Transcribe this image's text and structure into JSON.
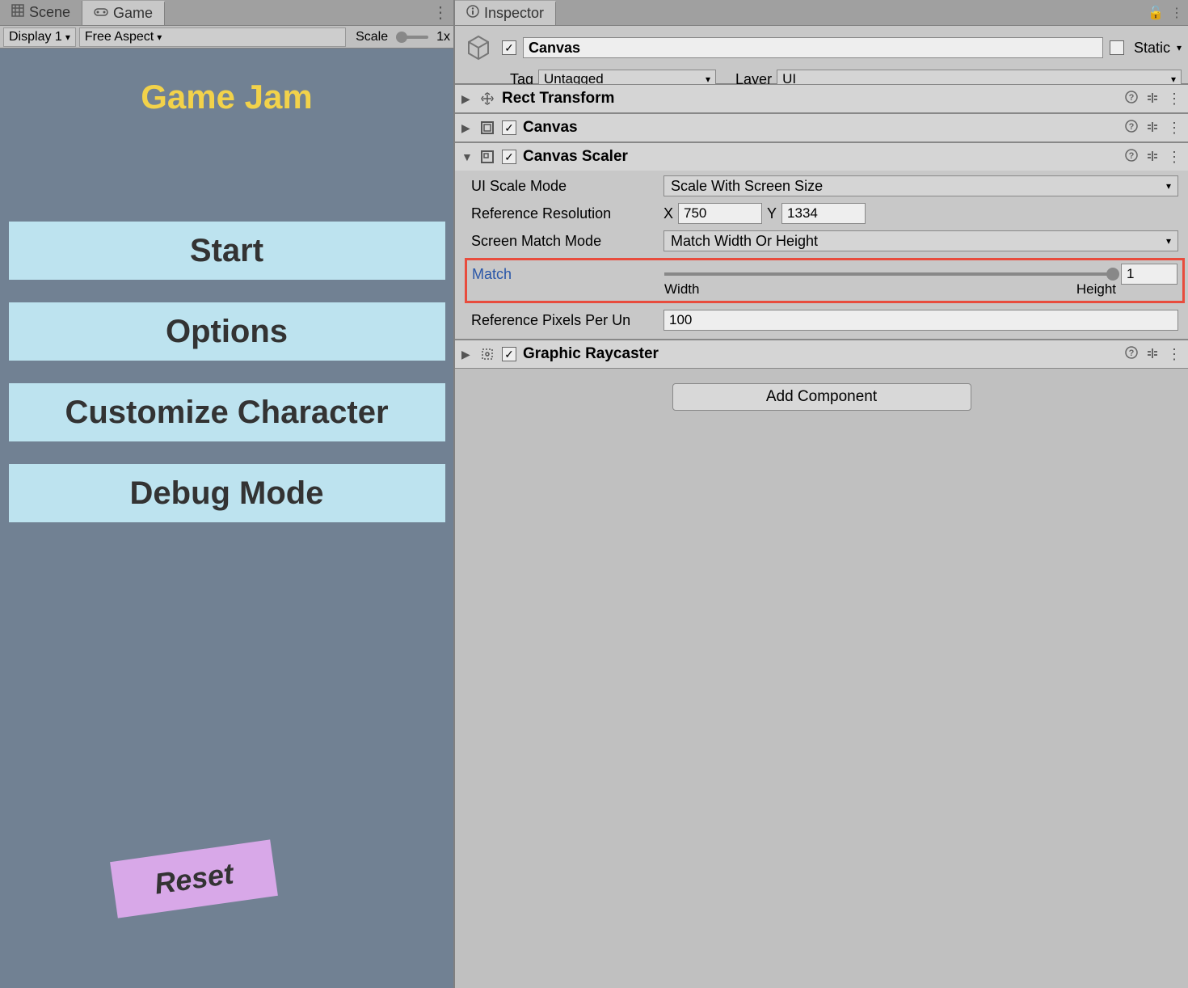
{
  "left": {
    "tabs": {
      "scene": "Scene",
      "game": "Game"
    },
    "toolbar": {
      "display": "Display 1",
      "aspect": "Free Aspect",
      "scale_label": "Scale",
      "scale_value": "1x"
    },
    "game_view": {
      "title": "Game Jam",
      "btn_start": "Start",
      "btn_options": "Options",
      "btn_customize": "Customize Character",
      "btn_debug": "Debug Mode",
      "btn_reset": "Reset"
    }
  },
  "inspector": {
    "tab": "Inspector",
    "name": "Canvas",
    "static": "Static",
    "tag_label": "Tag",
    "tag_value": "Untagged",
    "layer_label": "Layer",
    "layer_value": "UI",
    "components": {
      "rect_transform": "Rect Transform",
      "canvas": "Canvas",
      "canvas_scaler": {
        "title": "Canvas Scaler",
        "ui_scale_mode_label": "UI Scale Mode",
        "ui_scale_mode_value": "Scale With Screen Size",
        "ref_res_label": "Reference Resolution",
        "ref_res_x": "750",
        "ref_res_y": "1334",
        "match_mode_label": "Screen Match Mode",
        "match_mode_value": "Match Width Or Height",
        "match_label": "Match",
        "match_value": "1",
        "width_label": "Width",
        "height_label": "Height",
        "ref_ppu_label": "Reference Pixels Per Un",
        "ref_ppu_value": "100"
      },
      "graphic_raycaster": "Graphic Raycaster"
    },
    "add_component": "Add Component"
  },
  "glyphs": {
    "x": "X",
    "y": "Y",
    "check": "✓",
    "caret": "▾",
    "right": "▶",
    "down": "▼",
    "help": "?",
    "sliders": "⚙",
    "dots": "⋮",
    "lock": "🔓"
  }
}
